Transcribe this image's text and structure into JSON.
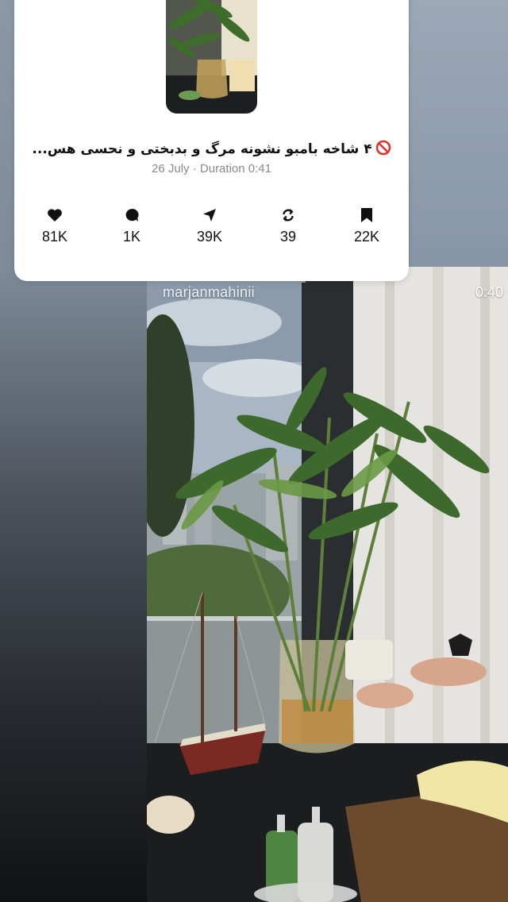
{
  "post": {
    "title": "۴ شاخه بامبو نشونه مرگ و بدبختی و نحسی هس...",
    "date": "26 July",
    "separator": "·",
    "duration_label": "Duration",
    "duration": "0:41"
  },
  "stats": {
    "likes": "81K",
    "comments": "1K",
    "shares": "39K",
    "reposts": "39",
    "saves": "22K"
  },
  "video": {
    "username": "marjanmahinii",
    "time": "0:40"
  },
  "icons": {
    "likes": "heart-icon",
    "comments": "comment-bubble-icon",
    "shares": "send-arrow-icon",
    "reposts": "repost-icon",
    "saves": "bookmark-icon",
    "title_prefix": "prohibited-icon"
  }
}
